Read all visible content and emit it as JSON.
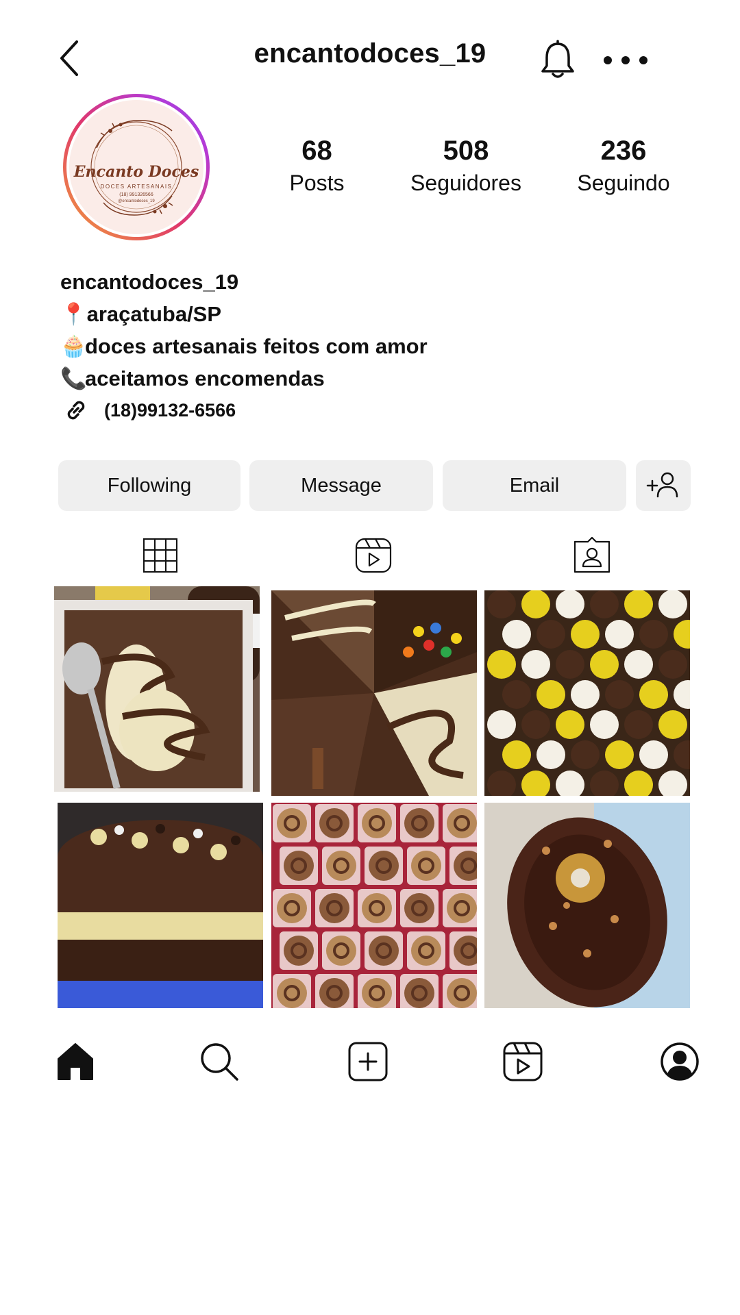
{
  "header": {
    "username": "encantodoces_19"
  },
  "avatar": {
    "brand_title": "Encanto Doces",
    "brand_subtitle": "DOCES ARTESANAIS",
    "brand_phone": "(18) 991326566",
    "brand_handle": "@encantodoces_19"
  },
  "stats": [
    {
      "value": "68",
      "label": "Posts"
    },
    {
      "value": "508",
      "label": "Seguidores"
    },
    {
      "value": "236",
      "label": "Seguindo"
    }
  ],
  "bio": {
    "name": "encantodoces_19",
    "location_emoji": "📍",
    "location": "araçatuba/SP",
    "line2_emoji": "🧁",
    "line2": "doces artesanais feitos com amor",
    "line3_emoji": "📞",
    "line3": "aceitamos encomendas",
    "link": "(18)99132-6566"
  },
  "actions": {
    "following": "Following",
    "message": "Message",
    "email": "Email"
  },
  "tabs": [
    "grid-icon",
    "reels-icon",
    "tagged-icon"
  ],
  "nav": [
    "home-icon",
    "search-icon",
    "new-post-icon",
    "reels-icon",
    "profile-icon"
  ],
  "colors": {
    "button_bg": "#efefef",
    "avatar_ring_start": "#f2a23a",
    "avatar_ring_end": "#8a47e8",
    "brand": "#7a3a22"
  }
}
